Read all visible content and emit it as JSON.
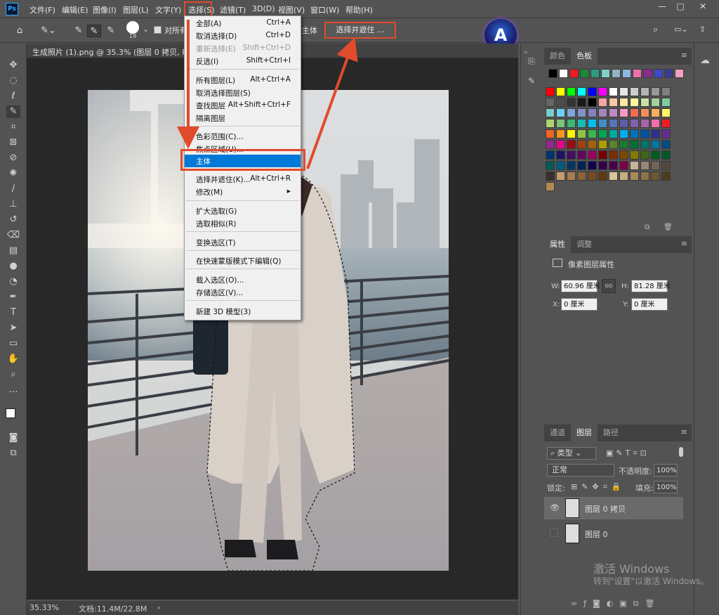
{
  "menubar": {
    "app_icon": "Ps",
    "items": [
      "文件(F)",
      "编辑(E)",
      "图像(I)",
      "图层(L)",
      "文字(Y)",
      "选择(S)",
      "滤镜(T)",
      "3D(D)",
      "视图(V)",
      "窗口(W)",
      "帮助(H)"
    ],
    "window_controls": [
      "—",
      "□",
      "✕"
    ]
  },
  "options": {
    "brush_size": "19",
    "sample_all_label": "对所有",
    "subject_label": "主体",
    "refine_label": "选择并遮住 ..."
  },
  "document": {
    "tab_title": "生成照片 (1).png @ 35.3% (图层 0 拷贝, RGB/8",
    "zoom": "35.33%",
    "doc_size": "文档:11.4M/22.8M"
  },
  "dropdown": {
    "items": [
      {
        "label": "全部(A)",
        "shortcut": "Ctrl+A",
        "disabled": false
      },
      {
        "label": "取消选择(D)",
        "shortcut": "Ctrl+D",
        "disabled": false
      },
      {
        "label": "重新选择(E)",
        "shortcut": "Shift+Ctrl+D",
        "disabled": true
      },
      {
        "label": "反选(I)",
        "shortcut": "Shift+Ctrl+I",
        "disabled": false
      },
      {
        "label": "所有图层(L)",
        "shortcut": "Alt+Ctrl+A",
        "disabled": false
      },
      {
        "label": "取消选择图层(S)",
        "shortcut": "",
        "disabled": false
      },
      {
        "label": "查找图层",
        "shortcut": "Alt+Shift+Ctrl+F",
        "disabled": false
      },
      {
        "label": "隔离图层",
        "shortcut": "",
        "disabled": false
      },
      {
        "label": "色彩范围(C)...",
        "shortcut": "",
        "disabled": false
      },
      {
        "label": "焦点区域(U)...",
        "shortcut": "",
        "disabled": false
      },
      {
        "label": "主体",
        "shortcut": "",
        "disabled": false,
        "highlighted": true
      },
      {
        "label": "选择并遮住(K)...",
        "shortcut": "Alt+Ctrl+R",
        "disabled": false
      },
      {
        "label": "修改(M)",
        "shortcut": "▸",
        "disabled": false
      },
      {
        "label": "扩大选取(G)",
        "shortcut": "",
        "disabled": false
      },
      {
        "label": "选取相似(R)",
        "shortcut": "",
        "disabled": false
      },
      {
        "label": "变换选区(T)",
        "shortcut": "",
        "disabled": false
      },
      {
        "label": "在快速蒙版模式下编辑(Q)",
        "shortcut": "",
        "disabled": false
      },
      {
        "label": "载入选区(O)...",
        "shortcut": "",
        "disabled": false
      },
      {
        "label": "存储选区(V)...",
        "shortcut": "",
        "disabled": false
      },
      {
        "label": "新建 3D 模型(3)",
        "shortcut": "",
        "disabled": false
      }
    ]
  },
  "color_panel": {
    "tabs": [
      "颜色",
      "色板"
    ],
    "row1": [
      "#000000",
      "#ffffff",
      "#ed1c24",
      "#1d8a3a",
      "#2e9b7e",
      "#7fd0c8",
      "#93b3c4",
      "#8fb8e0",
      "#f06ea9",
      "#8b2a8f",
      "#3f48cc",
      "#3b3b8f",
      "#f2a1c0"
    ],
    "grid": [
      [
        "#ff0000",
        "#ffff00",
        "#00ff00",
        "#00ffff",
        "#0000ff",
        "#ff00ff",
        "#ffffff",
        "#e6e6e6",
        "#cccccc",
        "#b3b3b3",
        "#999999",
        "#808080"
      ],
      [
        "#666666",
        "#4d4d4d",
        "#333333",
        "#1a1a1a",
        "#000000",
        "#f6a5a5",
        "#f8c9a1",
        "#fbe59f",
        "#fff79a",
        "#c8e3a3",
        "#a3d39c",
        "#7ecc9e"
      ],
      [
        "#7accc8",
        "#6dcff6",
        "#7da7d9",
        "#8393ca",
        "#8781bd",
        "#a187be",
        "#bd8cbf",
        "#f49ac2",
        "#f26c4f",
        "#f68e55",
        "#fbaf5c",
        "#fff467"
      ],
      [
        "#acd372",
        "#7cc576",
        "#3bb878",
        "#1abbb4",
        "#00bff3",
        "#438ccb",
        "#5574b9",
        "#605ca8",
        "#855fa8",
        "#a763a8",
        "#f06ea9",
        "#ed1c24"
      ],
      [
        "#f26522",
        "#f7941d",
        "#fff200",
        "#8dc73f",
        "#39b54a",
        "#00a651",
        "#00a99d",
        "#00aeef",
        "#0072bc",
        "#0054a6",
        "#2e3192",
        "#662d91"
      ],
      [
        "#92278f",
        "#ec008c",
        "#9e0b0f",
        "#a0410d",
        "#a36209",
        "#aba000",
        "#598527",
        "#1a7b30",
        "#007236",
        "#00746b",
        "#0076a3",
        "#004b80"
      ],
      [
        "#003471",
        "#1b1464",
        "#440e62",
        "#630460",
        "#9e005d",
        "#790000",
        "#7b2e00",
        "#7d4900",
        "#827b00",
        "#406618",
        "#005e20",
        "#005826"
      ],
      [
        "#005952",
        "#005b7f",
        "#003663",
        "#002157",
        "#0d004c",
        "#32004b",
        "#4b0049",
        "#7b0046",
        "#c7b299",
        "#998675",
        "#736357",
        "#534741"
      ],
      [
        "#37302a",
        "#c69c6d",
        "#a67c52",
        "#8c6239",
        "#754c24",
        "#603913",
        "#d9c39a",
        "#c7ae7e",
        "#a68b5b",
        "#8d7249",
        "#6e5831",
        "#4d3c1c"
      ],
      [
        "#b08a50"
      ]
    ]
  },
  "properties": {
    "tabs": [
      "属性",
      "调整"
    ],
    "title": "像素图层属性",
    "w_label": "W:",
    "w_value": "60.96 厘米",
    "h_label": "H:",
    "h_value": "81.28 厘米",
    "x_label": "X:",
    "x_value": "0 厘米",
    "y_label": "Y:",
    "y_value": "0 厘米",
    "link_icon": "GO"
  },
  "layers": {
    "tabs": [
      "通道",
      "图层",
      "路径"
    ],
    "filter_label": "类型",
    "blend_mode": "正常",
    "opacity_label": "不透明度:",
    "opacity": "100%",
    "lock_label": "锁定:",
    "fill_label": "填充:",
    "fill": "100%",
    "items": [
      {
        "name": "图层 0 拷贝",
        "visible": true,
        "selected": true
      },
      {
        "name": "图层 0",
        "visible": false,
        "selected": false
      }
    ]
  },
  "watermark": {
    "line1": "激活 Windows",
    "line2": "转到\"设置\"以激活 Windows。"
  },
  "logo_text": "A"
}
